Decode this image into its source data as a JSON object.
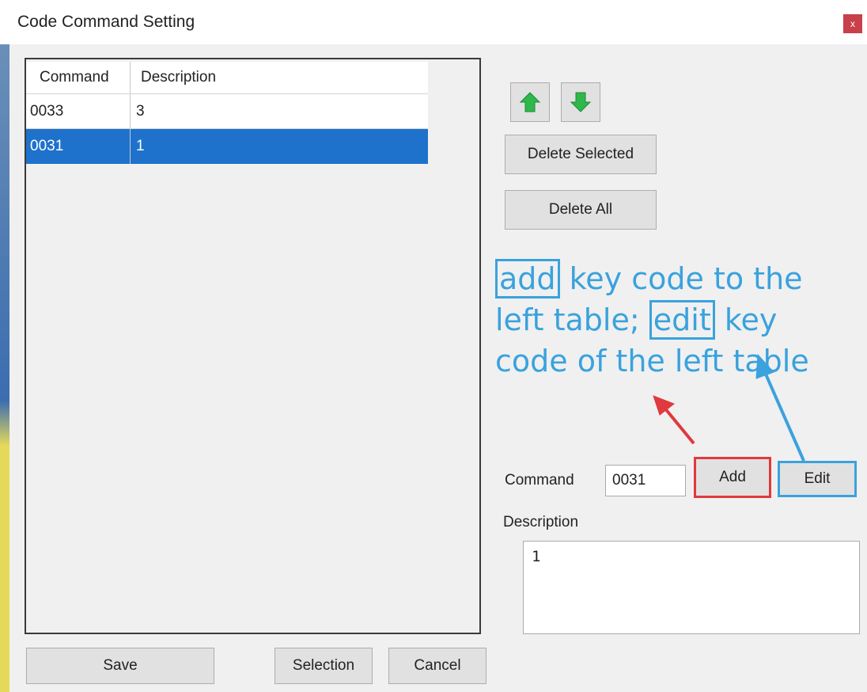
{
  "window": {
    "title": "Code Command Setting",
    "close_glyph": "x"
  },
  "table": {
    "headers": [
      "Command",
      "Description"
    ],
    "rows": [
      {
        "command": "0033",
        "description": "3"
      },
      {
        "command": "0031",
        "description": "1"
      }
    ],
    "selected_index": 1
  },
  "toolbar": {
    "move_up_icon": "move-up-icon",
    "move_down_icon": "move-down-icon",
    "delete_selected_label": "Delete Selected",
    "delete_all_label": "Delete All"
  },
  "annotation": {
    "add_word": "add",
    "part1": "key code to the left table;",
    "edit_word": "edit",
    "part2": "key code of the left table",
    "text_color": "#3aa2dd",
    "add_highlight_color": "#e0393e",
    "edit_highlight_color": "#3aa2dd"
  },
  "form": {
    "command_label": "Command",
    "command_value": "0031",
    "add_label": "Add",
    "edit_label": "Edit",
    "description_label": "Description",
    "description_value": "1"
  },
  "footer": {
    "save_label": "Save",
    "selection_label": "Selection",
    "cancel_label": "Cancel"
  },
  "colors": {
    "selection": "#1e72cc",
    "window_bg": "#f0f0f0"
  }
}
